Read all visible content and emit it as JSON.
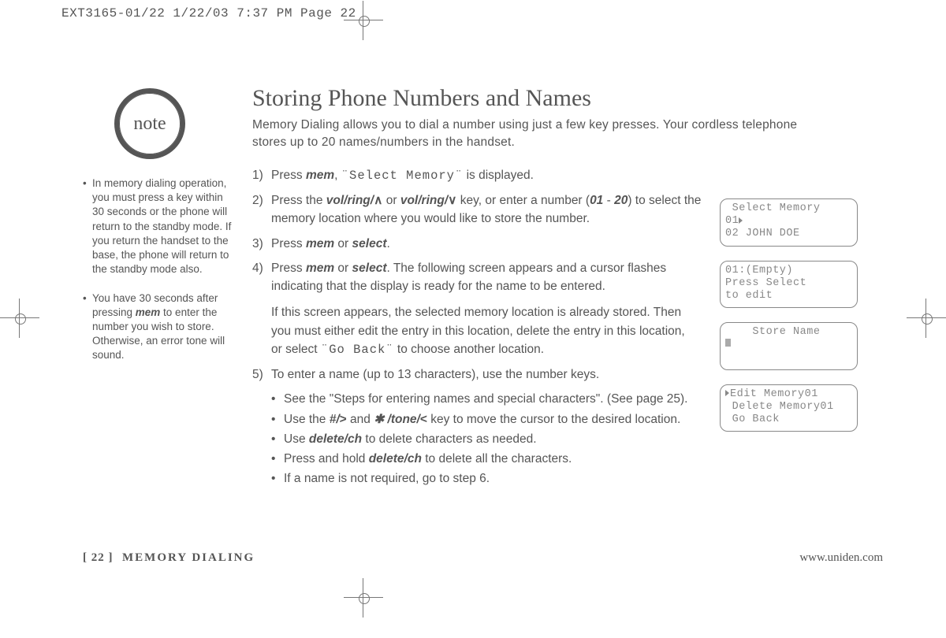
{
  "header": {
    "slug": "EXT3165-01/22  1/22/03  7:37 PM  Page 22"
  },
  "note": {
    "badge": "note",
    "items": [
      {
        "text": "In memory dialing operation, you must press a key within 30 seconds or the phone will return to the standby mode. If you return the handset to the base, the phone will return to the standby mode also."
      },
      {
        "prefix": "You have 30 seconds after pressing ",
        "bold": "mem",
        "suffix": " to enter the number you wish to store. Otherwise, an error tone will sound."
      }
    ]
  },
  "main": {
    "title": "Storing Phone Numbers and Names",
    "intro": "Memory Dialing allows you to dial a number using just a few key presses. Your cordless telephone stores up to 20 names/numbers in the handset.",
    "s1": {
      "n": "1)",
      "a": "Press ",
      "b": "mem",
      "c": ", ",
      "lcd": "¨Select Memory¨",
      "d": " is displayed."
    },
    "s2": {
      "n": "2)",
      "a": "Press the ",
      "b1": "vol/ring/",
      "up": "∧",
      "c": "  or ",
      "b2": "vol/ring/",
      "dn": "∨",
      "d": " key, or enter a number (",
      "b3": "01",
      "dash": " - ",
      "b4": "20",
      "e": ") to select the memory location where you would like to store the number."
    },
    "s3": {
      "n": "3)",
      "a": "Press ",
      "b1": "mem",
      "c": " or ",
      "b2": "select",
      "d": "."
    },
    "s4": {
      "n": "4)",
      "a": "Press ",
      "b1": "mem",
      "c": " or ",
      "b2": "select",
      "d": ". The following screen appears and a cursor flashes indicating that the display is ready for the name to be entered.",
      "p2a": "If this screen appears, the selected memory location is already stored. Then you must either edit the entry in this location, delete the entry in this location, or select ",
      "p2lcd": "¨Go Back¨",
      "p2b": " to choose another location."
    },
    "s5": {
      "n": "5)",
      "a": "To enter a name (up to 13 characters), use the number keys."
    },
    "bul": {
      "b1": "See the \"Steps for entering names and special characters\". (See page 25).",
      "b2a": "Use the ",
      "b2k1": "#/",
      "b2gt": ">",
      "b2b": " and  ",
      "b2k2": " /tone/",
      "b2lt": "<",
      "b2c": " key to move the cursor to the desired location.",
      "b3a": "Use ",
      "b3k": "delete/ch",
      "b3b": " to delete characters as needed.",
      "b4a": "Press and hold ",
      "b4k": "delete/ch",
      "b4b": " to delete all the characters.",
      "b5": "If a name is not required, go to step 6."
    }
  },
  "lcd": {
    "d1l1": " Select Memory",
    "d1l2": "01",
    "d1l3": "02 JOHN DOE",
    "d2l1": "01:(Empty)",
    "d2l2": "Press Select",
    "d2l3": "to edit",
    "d3l1": "    Store Name",
    "d4l1": "Edit Memory01",
    "d4l2": " Delete Memory01",
    "d4l3": " Go Back"
  },
  "footer": {
    "page": "[ 22 ]",
    "section": "MEMORY DIALING",
    "url": "www.uniden.com"
  }
}
